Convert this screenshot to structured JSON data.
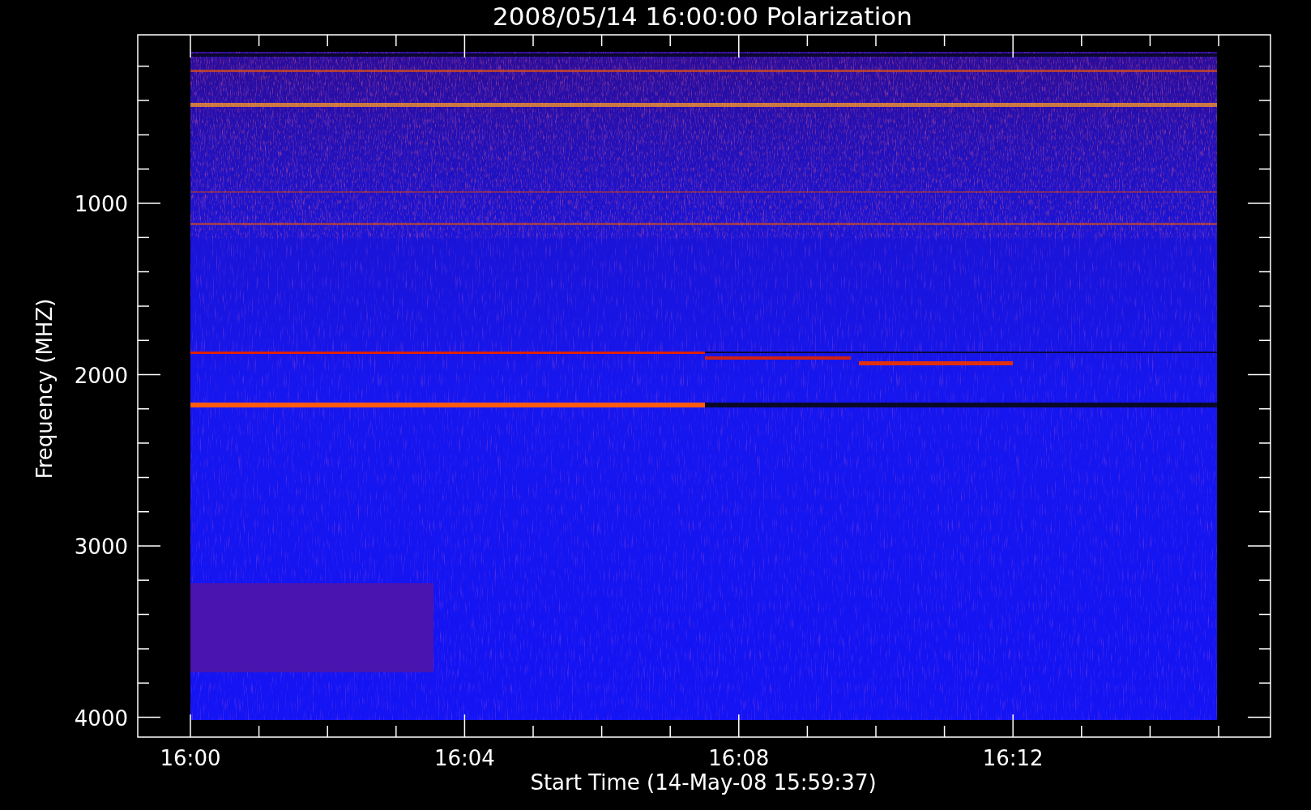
{
  "title": "2008/05/14 16:00:00 Polarization",
  "y_axis": {
    "label": "Frequency (MHZ)",
    "ticks": [
      "1000",
      "2000",
      "3000",
      "4000"
    ]
  },
  "x_axis": {
    "label": "Start Time (14-May-08 15:59:37)",
    "ticks": [
      "16:00",
      "16:04",
      "16:08",
      "16:12"
    ]
  }
}
